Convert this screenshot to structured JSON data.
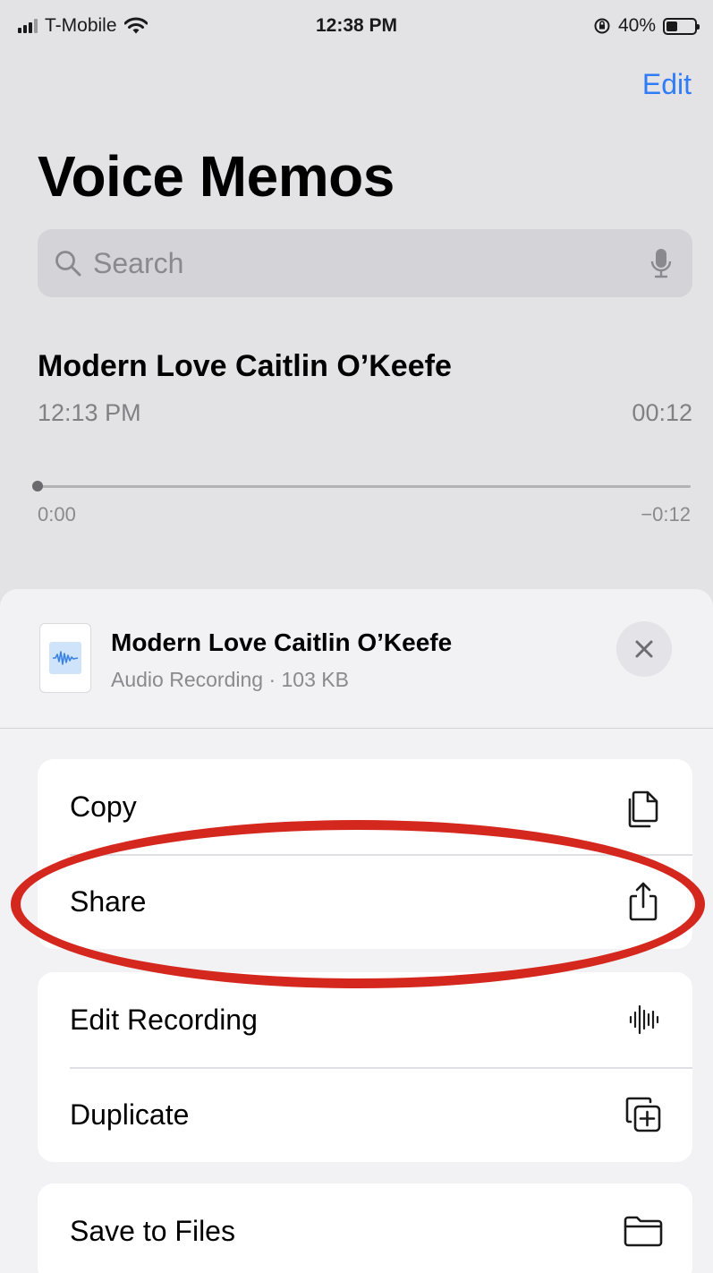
{
  "status_bar": {
    "carrier": "T-Mobile",
    "time": "12:38 PM",
    "battery": "40%",
    "battery_level": 0.4,
    "icons": [
      "signal-icon",
      "wifi-icon",
      "orientation-lock-icon",
      "battery-icon"
    ]
  },
  "header": {
    "edit_label": "Edit",
    "title": "Voice Memos"
  },
  "search": {
    "placeholder": "Search",
    "icons": [
      "search-icon",
      "microphone-icon"
    ]
  },
  "recording": {
    "title": "Modern Love Caitlin O’Keefe",
    "date": "12:13 PM",
    "duration": "00:12",
    "elapsed": "0:00",
    "remaining": "−0:12",
    "progress": 0
  },
  "share_sheet": {
    "file_title": "Modern Love Caitlin O’Keefe",
    "file_subtitle": "Audio Recording · 103 KB",
    "icons": [
      "audio-file-icon",
      "close-icon"
    ],
    "actions": [
      {
        "label": "Copy",
        "icon": "copy-icon"
      },
      {
        "label": "Share",
        "icon": "share-icon"
      },
      {
        "label": "Edit Recording",
        "icon": "waveform-icon"
      },
      {
        "label": "Duplicate",
        "icon": "duplicate-icon"
      },
      {
        "label": "Save to Files",
        "icon": "folder-icon"
      }
    ]
  },
  "colors": {
    "accent": "#2f7cf6",
    "annotation": "#d4271d",
    "background": "#e3e3e6",
    "sheet": "#f2f2f5"
  }
}
